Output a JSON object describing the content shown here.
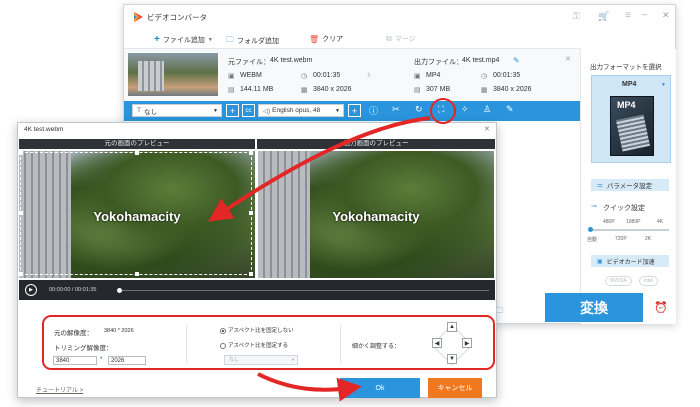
{
  "main_window": {
    "title": "ビデオコンバータ",
    "toolbar": {
      "add_file": "ファイル追加",
      "add_folder": "フォルダ追加",
      "clear": "クリア",
      "merge": "マージ"
    },
    "source": {
      "label": "元ファイル：",
      "name": "4K test.webm",
      "format": "WEBM",
      "duration": "00:01:35",
      "size": "144.11 MB",
      "resolution": "3840 x 2026"
    },
    "output": {
      "label": "出力ファイル：",
      "name": "4K test.mp4",
      "format": "MP4",
      "duration": "00:01:35",
      "size": "307 MB",
      "resolution": "3840 x 2026"
    },
    "subtitle_select": "なし",
    "audio_select": "English opus, 48",
    "right_panel": {
      "format_heading": "出力フォーマットを選択",
      "format_value": "MP4",
      "format_icon_text": "MP4",
      "param_button": "パラメータ設定",
      "quick_heading": "クイック設定",
      "quality_top": [
        "480P",
        "1080P",
        "4K"
      ],
      "quality_bottom": [
        "自動",
        "720P",
        "2K"
      ],
      "gpu_label": "ビデオカード加速",
      "gpu_vendors": [
        "NVIDIA",
        "intel"
      ]
    },
    "convert_button": "変換"
  },
  "dialog": {
    "title": "4K test.webm",
    "orig_preview": "元の画面のプレビュー",
    "out_preview": "出力画面のプレビュー",
    "watermark": "Yokohamacity",
    "time": "00:00:00 / 00:01:35",
    "resolution_label": "元の解像度：",
    "resolution_value": "3840 * 2026",
    "trim_label": "トリミング解像度：",
    "trim_w": "3840",
    "trim_sep": "*",
    "trim_h": "2026",
    "aspect_free": "アスペクト比を固定しない",
    "aspect_fixed": "アスペクト比を固定する",
    "ratio_select": "なし",
    "fine_tune": "細かく調整する：",
    "tutorial": "チュートリアル >",
    "ok": "Ok",
    "cancel": "キャンセル"
  },
  "colors": {
    "accent": "#2a95dc",
    "highlight": "#e32626",
    "cancel": "#f0781e"
  }
}
